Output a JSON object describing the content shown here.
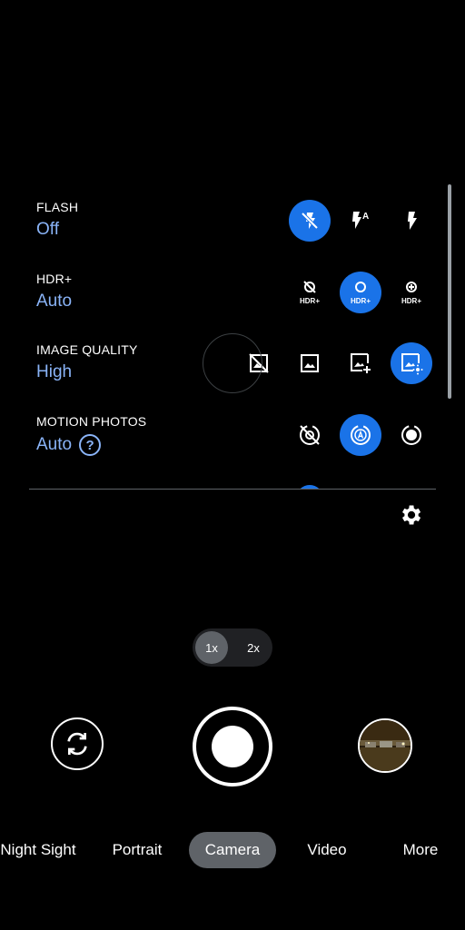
{
  "settings": [
    {
      "label": "FLASH",
      "value": "Off",
      "options": [
        "flash-off-icon",
        "flash-auto-icon",
        "flash-on-icon"
      ],
      "selected": 0
    },
    {
      "label": "HDR+",
      "value": "Auto",
      "options": [
        "hdr-off-icon",
        "hdr-auto-icon",
        "hdr-enhanced-icon"
      ],
      "selected": 1
    },
    {
      "label": "IMAGE QUALITY",
      "value": "High",
      "options": [
        "quality-off-icon",
        "quality-standard-icon",
        "quality-plus-icon",
        "quality-high-icon"
      ],
      "selected": 3
    },
    {
      "label": "MOTION PHOTOS",
      "value": "Auto",
      "options": [
        "motion-off-icon",
        "motion-auto-icon",
        "motion-on-icon"
      ],
      "selected": 1
    }
  ],
  "option_badges": {
    "hdr": "HDR+",
    "flash_auto": "A"
  },
  "zoom": {
    "options": [
      "1x",
      "2x"
    ],
    "selected": "1x"
  },
  "modes": [
    "Night Sight",
    "Portrait",
    "Camera",
    "Video",
    "More"
  ],
  "active_mode": "Camera",
  "colors": {
    "accent": "#1a73e8",
    "value_text": "#8ab4f8",
    "background": "#000000",
    "chip": "#5f6368"
  }
}
